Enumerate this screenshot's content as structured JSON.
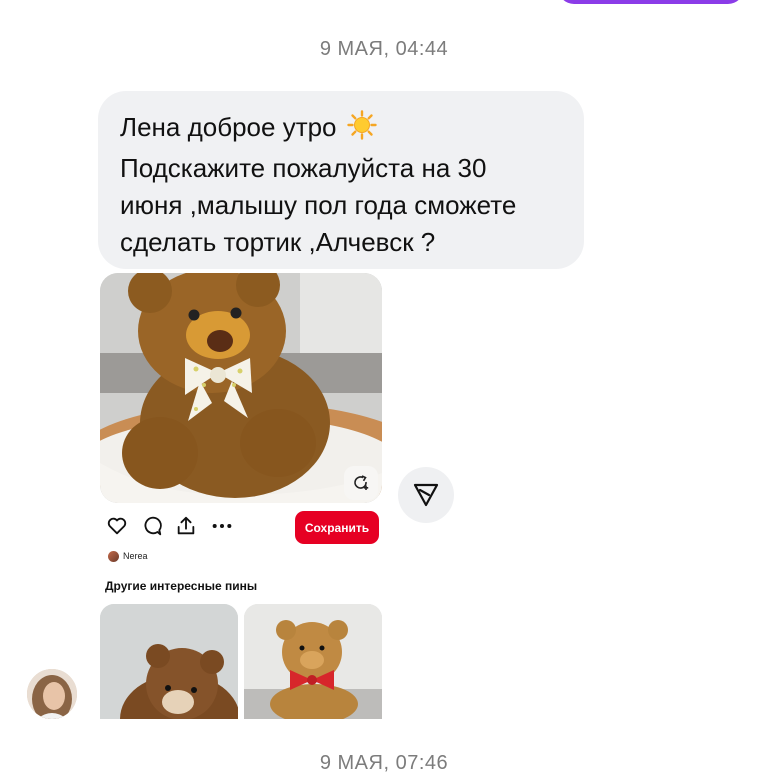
{
  "top_bubble_color": "#8b3ce8",
  "timestamps": {
    "first": "9 МАЯ, 04:44",
    "second": "9 МАЯ, 07:46"
  },
  "message": {
    "lines": [
      "Лена доброе утро",
      "Подскажите пожалуйста на 30",
      "июня ,малышу пол года сможете",
      "сделать тортик ,Алчевск ?"
    ],
    "emoji_icon": "sun-icon"
  },
  "pin": {
    "save_label": "Сохранить",
    "author": "Nerea",
    "more_pins_title": "Другие интересные пины",
    "brand_color": "#e60023",
    "icons": [
      "heart-icon",
      "comment-icon",
      "share-icon",
      "more-icon",
      "repin-icon"
    ]
  },
  "share_icon": "send-icon"
}
